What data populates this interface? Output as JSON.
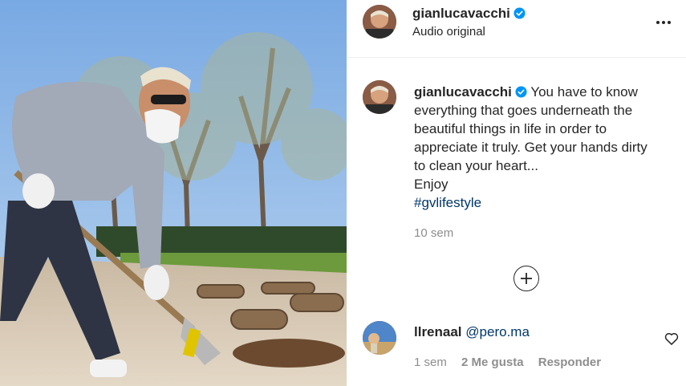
{
  "post": {
    "author": "gianlucavacchi",
    "audio_label": "Audio original",
    "caption_lines": [
      "You have to know",
      "everything that goes underneath the",
      "beautiful things in life in order to",
      "appreciate it truly. Get your hands dirty",
      "to clean your heart...",
      "Enjoy"
    ],
    "hashtag": "#gvlifestyle",
    "time": "10 sem"
  },
  "comment": {
    "author": "llrenaal",
    "mention": "@pero.ma",
    "time": "1 sem",
    "likes": "2 Me gusta",
    "reply_label": "Responder"
  },
  "icons": {
    "verified": "verified-badge-icon",
    "more": "more-options-icon",
    "load_more": "plus-circle-icon",
    "like": "heart-icon"
  },
  "colors": {
    "link": "#00376b",
    "verified": "#0095f6",
    "muted": "#8e8e8e",
    "text": "#262626"
  }
}
